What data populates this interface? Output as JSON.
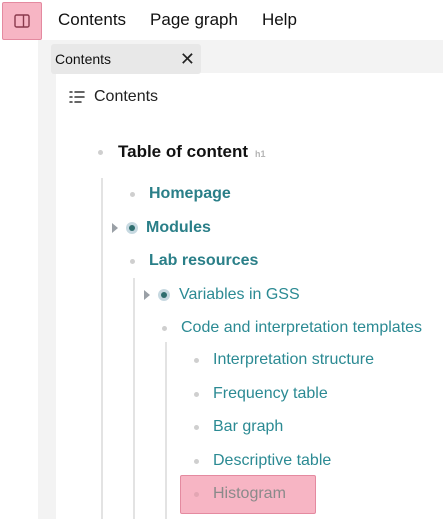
{
  "menubar": {
    "items": [
      "Contents",
      "Page graph",
      "Help"
    ]
  },
  "tab": {
    "label": "Contents",
    "close_glyph": "✕"
  },
  "panel": {
    "header": "Contents"
  },
  "toc": {
    "title": "Table of content",
    "title_tag": "h1",
    "items": [
      {
        "label": "Homepage"
      },
      {
        "label": "Modules"
      },
      {
        "label": "Lab resources"
      },
      {
        "label": "Variables in GSS"
      },
      {
        "label": "Code and interpretation templates"
      },
      {
        "label": "Interpretation structure"
      },
      {
        "label": "Frequency table"
      },
      {
        "label": "Bar graph"
      },
      {
        "label": "Descriptive table"
      },
      {
        "label": "Histogram"
      }
    ]
  },
  "icons": {
    "sidebar_toggle": "sidebar-panel-icon",
    "toc": "toc-list-icon",
    "collapsed": "collapsed-node-icon",
    "expand": "expand-caret-icon"
  },
  "colors": {
    "highlight": "#f7b5c4",
    "link": "#2b8a93"
  }
}
